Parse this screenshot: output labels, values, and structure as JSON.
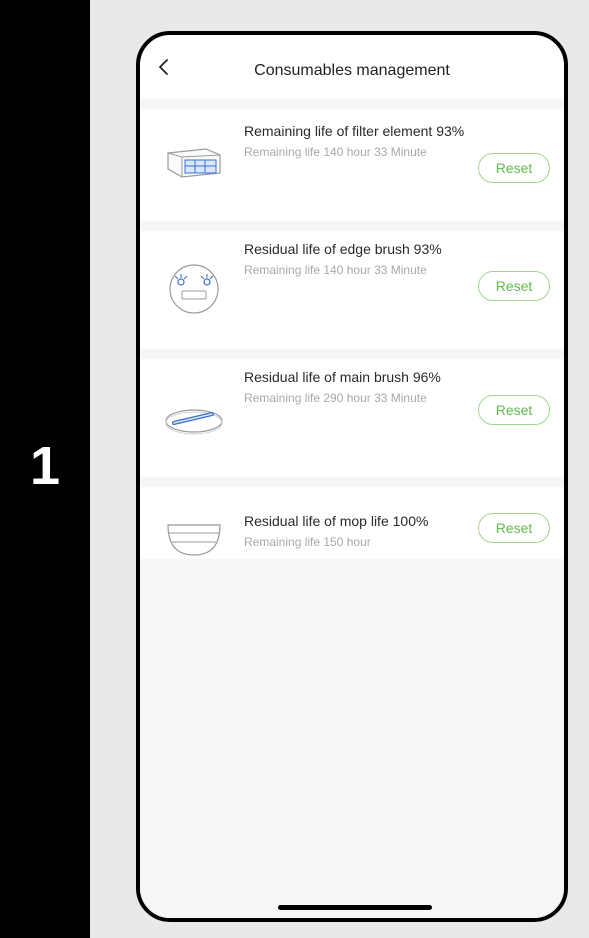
{
  "step": {
    "number": "1"
  },
  "app": {
    "title": "Consumables management",
    "back_icon": "chevron-left-icon"
  },
  "items": [
    {
      "name": "Remaining life of filter element 93%",
      "remaining": "Remaining life 140 hour 33 Minute",
      "reset_label": "Reset",
      "icon": "filter-element-icon"
    },
    {
      "name": "Residual life of edge brush 93%",
      "remaining": "Remaining life 140 hour 33 Minute",
      "reset_label": "Reset",
      "icon": "edge-brush-icon"
    },
    {
      "name": "Residual life of main brush 96%",
      "remaining": "Remaining life 290 hour 33 Minute",
      "reset_label": "Reset",
      "icon": "main-brush-icon"
    },
    {
      "name": "Residual life of mop life 100%",
      "remaining": "Remaining life 150 hour",
      "reset_label": "Reset",
      "icon": "mop-icon"
    }
  ],
  "colors": {
    "accent_green": "#5fbd48",
    "icon_blue": "#3a6fd0",
    "background_gray": "#e9e9e9"
  }
}
